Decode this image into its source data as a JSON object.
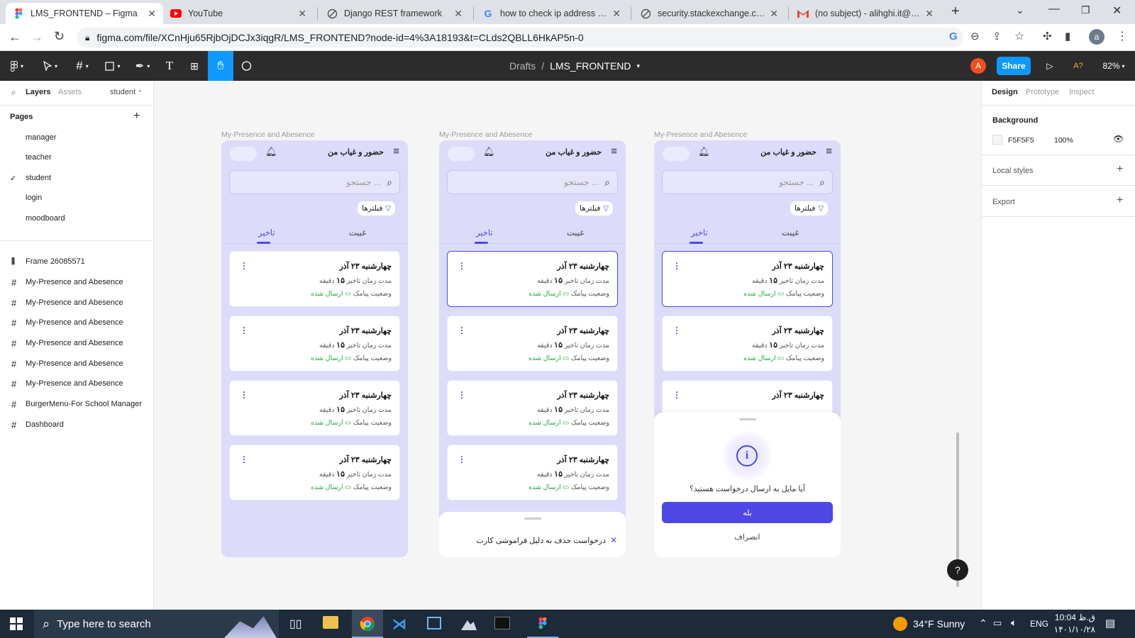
{
  "browser": {
    "tabs": [
      {
        "title": "LMS_FRONTEND – Figma",
        "active": true
      },
      {
        "title": "YouTube"
      },
      {
        "title": "Django REST framework"
      },
      {
        "title": "how to check ip address of w"
      },
      {
        "title": "security.stackexchange.com"
      },
      {
        "title": "(no subject) - alihghi.it@gma"
      }
    ],
    "url": "figma.com/file/XCnHju65RjbOjDCJx3iqgR/LMS_FRONTEND?node-id=4%3A18193&t=CLds2QBLL6HkAP5n-0",
    "avatar_letter": "a"
  },
  "figma": {
    "breadcrumb_root": "Drafts",
    "breadcrumb_sep": "/",
    "file_name": "LMS_FRONTEND",
    "user_initial": "A",
    "share_label": "Share",
    "ai_label": "A?",
    "zoom": "82%"
  },
  "left_panel": {
    "tabs": [
      "Layers",
      "Assets"
    ],
    "page_selector": "student",
    "pages_title": "Pages",
    "pages": [
      "manager",
      "teacher",
      "student",
      "login",
      "moodboard"
    ],
    "current_page": "student",
    "layers": [
      "Frame 26085571",
      "My-Presence and Abesence",
      "My-Presence and Abesence",
      "My-Presence and Abesence",
      "My-Presence and Abesence",
      "My-Presence and Abesence",
      "My-Presence and Abesence",
      "BurgerMenu-For School Manager",
      "Dashboard"
    ]
  },
  "right_panel": {
    "tabs": [
      "Design",
      "Prototype",
      "Inspect"
    ],
    "background_title": "Background",
    "bg_hex": "F5F5F5",
    "bg_opacity": "100%",
    "local_styles": "Local styles",
    "export": "Export"
  },
  "frames": {
    "label": "My-Presence and Abesence",
    "header_title": "حضور و غیاب من",
    "search_placeholder": "جستجو ...",
    "filter_label": "فیلترها",
    "tab_absence": "غیبت",
    "tab_delay": "تاخیر",
    "card": {
      "date": "چهارشنبه ۲۳ آذر",
      "delay_label": "مدت زمان تاخیر",
      "delay_value": "۱۵",
      "delay_unit": "دقیقه",
      "sms_label": "وضعیت پیامک",
      "sms_status": "ارسال شده"
    },
    "sheet2_text": "درخواست حذف به دلیل فراموشی کارت",
    "dialog_question": "آیا مایل به ارسال درخواست هستید؟",
    "dialog_yes": "بله",
    "dialog_cancel": "انصراف"
  },
  "taskbar": {
    "search_placeholder": "Type here to search",
    "weather": "34°F  Sunny",
    "lang": "ENG",
    "time": "10:04 ق.ظ",
    "date": "۱۴۰۱/۱۰/۲۸"
  },
  "colors": {
    "accent": "#5048e5",
    "figma_share": "#0d99ff",
    "frame_bg": "#dcdbfa",
    "canvas_bg": "#f5f5f5",
    "success": "#22a745"
  }
}
